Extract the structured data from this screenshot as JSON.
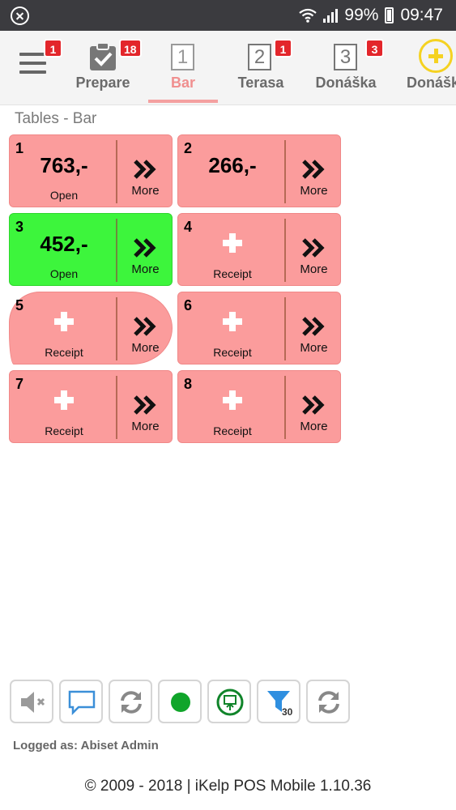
{
  "status_bar": {
    "battery": "99%",
    "time": "09:47"
  },
  "nav": {
    "menu_badge": "1",
    "items": [
      {
        "label": "Prepare",
        "badge": "18"
      },
      {
        "label": "Bar",
        "icon_number": "1",
        "badge": "",
        "active": true
      },
      {
        "label": "Terasa",
        "icon_number": "2",
        "badge": "1"
      },
      {
        "label": "Donáška",
        "icon_number": "3",
        "badge": "3"
      },
      {
        "label": "Donášk",
        "icon": "plus-circle-icon"
      }
    ]
  },
  "section_title": "Tables - Bar",
  "tables": [
    {
      "number": "1",
      "amount": "763,-",
      "status": "Open",
      "more": "More",
      "state": "open"
    },
    {
      "number": "2",
      "amount": "266,-",
      "status": "",
      "more": "More",
      "state": "open"
    },
    {
      "number": "3",
      "amount": "452,-",
      "status": "Open",
      "more": "More",
      "state": "active"
    },
    {
      "number": "4",
      "amount": "",
      "status": "Receipt",
      "more": "More",
      "state": "empty"
    },
    {
      "number": "5",
      "amount": "",
      "status": "Receipt",
      "more": "More",
      "state": "empty"
    },
    {
      "number": "6",
      "amount": "",
      "status": "Receipt",
      "more": "More",
      "state": "empty"
    },
    {
      "number": "7",
      "amount": "",
      "status": "Receipt",
      "more": "More",
      "state": "empty"
    },
    {
      "number": "8",
      "amount": "",
      "status": "Receipt",
      "more": "More",
      "state": "empty"
    }
  ],
  "toolbar": {
    "buttons": [
      "mute-icon",
      "chat-icon",
      "refresh-icon",
      "status-dot-icon",
      "upload-icon",
      "filter-icon",
      "sync-icon"
    ],
    "filter_count": "30"
  },
  "logged_as": "Logged as: Abiset Admin",
  "footer": "© 2009 - 2018 | iKelp POS Mobile 1.10.36",
  "colors": {
    "tile_red": "#fb9c9c",
    "tile_green": "#3df53c",
    "active_tab": "#f08f8f",
    "badge": "#e3262b"
  }
}
